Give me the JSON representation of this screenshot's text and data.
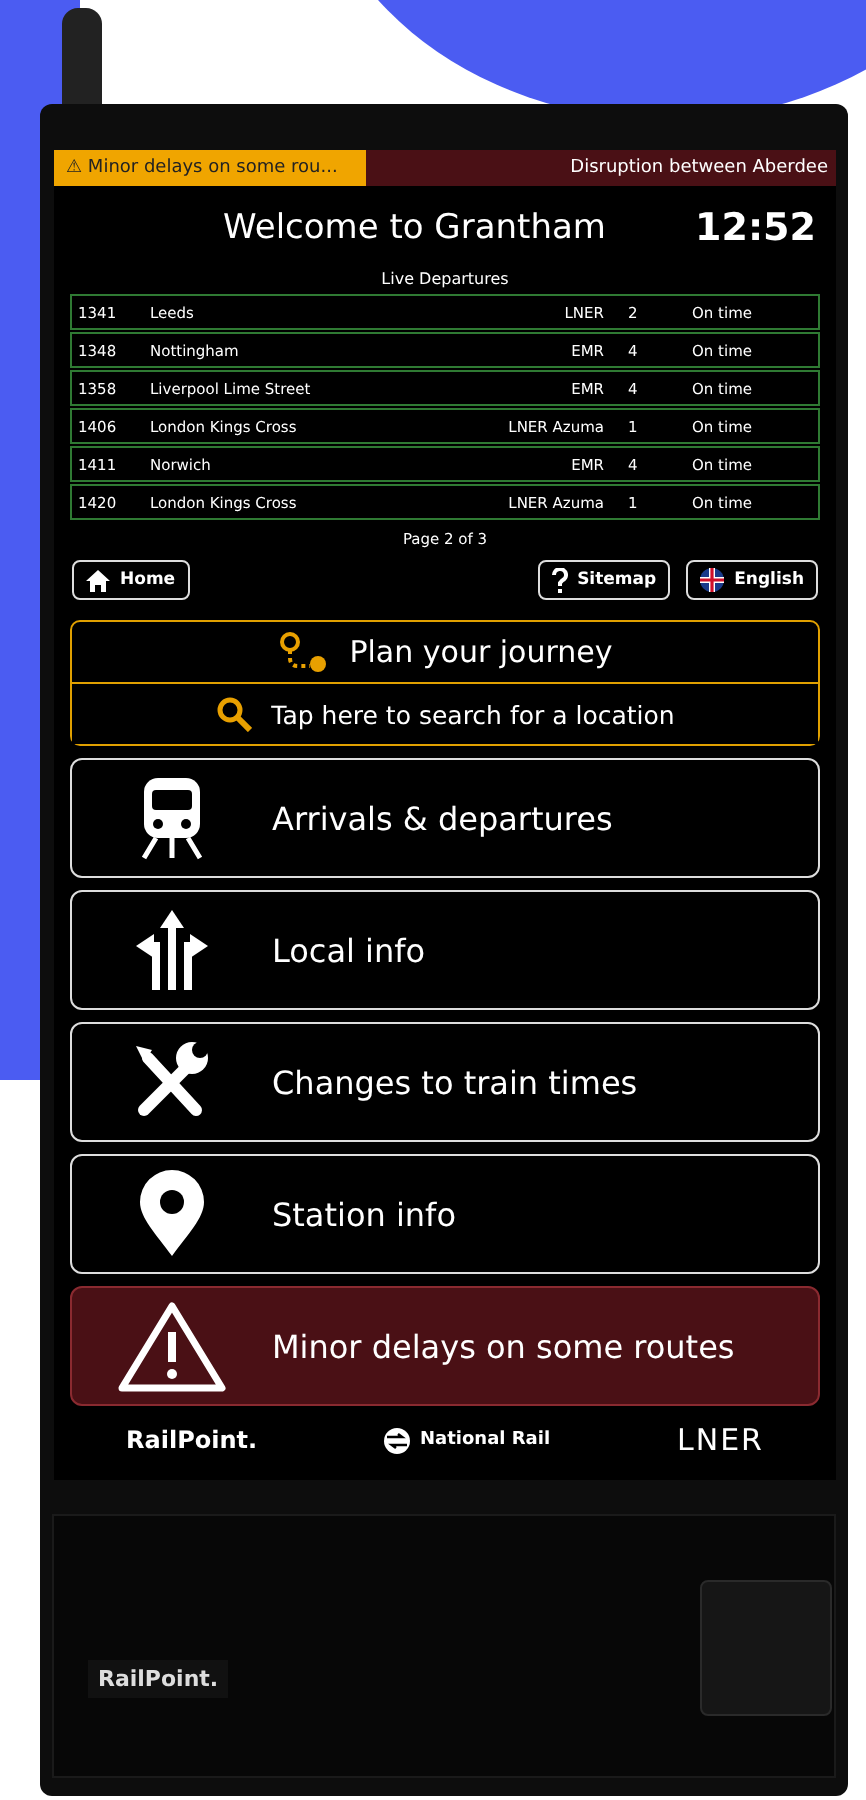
{
  "ticker": {
    "alert": "⚠ Minor delays on some rou...",
    "scrolling": "Disruption between Aberdee"
  },
  "header": {
    "title": "Welcome to Grantham",
    "clock": "12:52"
  },
  "departures": {
    "title": "Live Departures",
    "rows": [
      {
        "time": "1341",
        "destination": "Leeds",
        "operator": "LNER",
        "platform": "2",
        "status": "On time"
      },
      {
        "time": "1348",
        "destination": "Nottingham",
        "operator": "EMR",
        "platform": "4",
        "status": "On time"
      },
      {
        "time": "1358",
        "destination": "Liverpool Lime Street",
        "operator": "EMR",
        "platform": "4",
        "status": "On time"
      },
      {
        "time": "1406",
        "destination": "London Kings Cross",
        "operator": "LNER Azuma",
        "platform": "1",
        "status": "On time"
      },
      {
        "time": "1411",
        "destination": "Norwich",
        "operator": "EMR",
        "platform": "4",
        "status": "On time"
      },
      {
        "time": "1420",
        "destination": "London Kings Cross",
        "operator": "LNER Azuma",
        "platform": "1",
        "status": "On time"
      }
    ],
    "page": "Page 2 of 3"
  },
  "nav": {
    "home": "Home",
    "sitemap": "Sitemap",
    "language": "English"
  },
  "journey": {
    "title": "Plan your journey",
    "search": "Tap here to search for a location"
  },
  "menu": [
    {
      "label": "Arrivals & departures",
      "kind": "normal"
    },
    {
      "label": "Local info",
      "kind": "normal"
    },
    {
      "label": "Changes to train times",
      "kind": "normal"
    },
    {
      "label": "Station info",
      "kind": "normal"
    },
    {
      "label": "Minor delays on some routes",
      "kind": "alert"
    }
  ],
  "footer": {
    "railpoint": "RailPoint.",
    "national_rail": "National Rail",
    "operator": "LNER"
  },
  "cabinet_label": "RailPoint."
}
